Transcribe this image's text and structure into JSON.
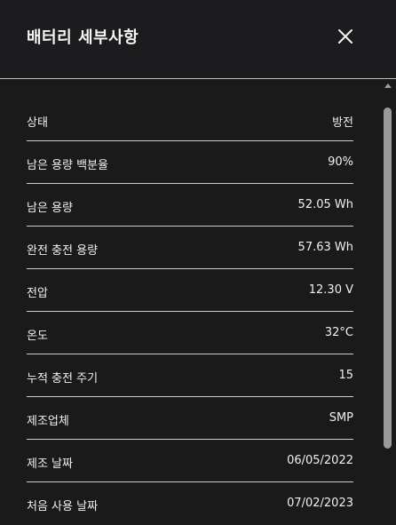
{
  "dialog": {
    "title": "배터리 세부사항",
    "close_icon": "close-icon"
  },
  "details": [
    {
      "label": "상태",
      "value": "방전"
    },
    {
      "label": "남은 용량 백분율",
      "value": "90%"
    },
    {
      "label": "남은 용량",
      "value": "52.05 Wh"
    },
    {
      "label": "완전 충전 용량",
      "value": "57.63 Wh"
    },
    {
      "label": "전압",
      "value": "12.30 V"
    },
    {
      "label": "온도",
      "value": "32°C"
    },
    {
      "label": "누적 충전 주기",
      "value": "15"
    },
    {
      "label": "제조업체",
      "value": "SMP"
    },
    {
      "label": "제조 날짜",
      "value": "06/05/2022"
    },
    {
      "label": "처음 사용 날짜",
      "value": "07/02/2023"
    }
  ]
}
